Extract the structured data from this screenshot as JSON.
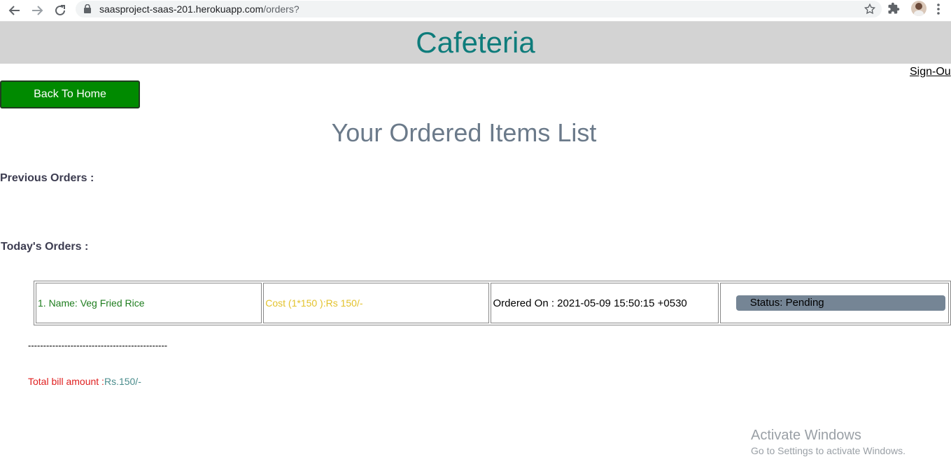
{
  "browser": {
    "url_host": "saasproject-saas-201.herokuapp.com",
    "url_path": "/orders?"
  },
  "header": {
    "title": "Cafeteria",
    "signout_label": "Sign-Ou"
  },
  "back_button_label": "Back To Home",
  "page_heading": "Your Ordered Items List",
  "previous_orders_label": "Previous Orders :",
  "todays_orders_label": "Today's Orders :",
  "orders": [
    {
      "name": "1. Name: Veg Fried Rice",
      "cost": "Cost (1*150 ):Rs 150/-",
      "ordered_on": "Ordered On : 2021-05-09 15:50:15 +0530",
      "status": "Status: Pending"
    }
  ],
  "divider": "----------------------------------------------",
  "total": {
    "label": "Total bill amount :",
    "amount": "Rs.150/-"
  },
  "watermark": {
    "line1": "Activate Windows",
    "line2": "Go to Settings to activate Windows."
  },
  "colors": {
    "header_bg": "#d3d3d3",
    "title": "#0e7c7b",
    "back_button": "#008a00",
    "status_pill": "#758595"
  }
}
